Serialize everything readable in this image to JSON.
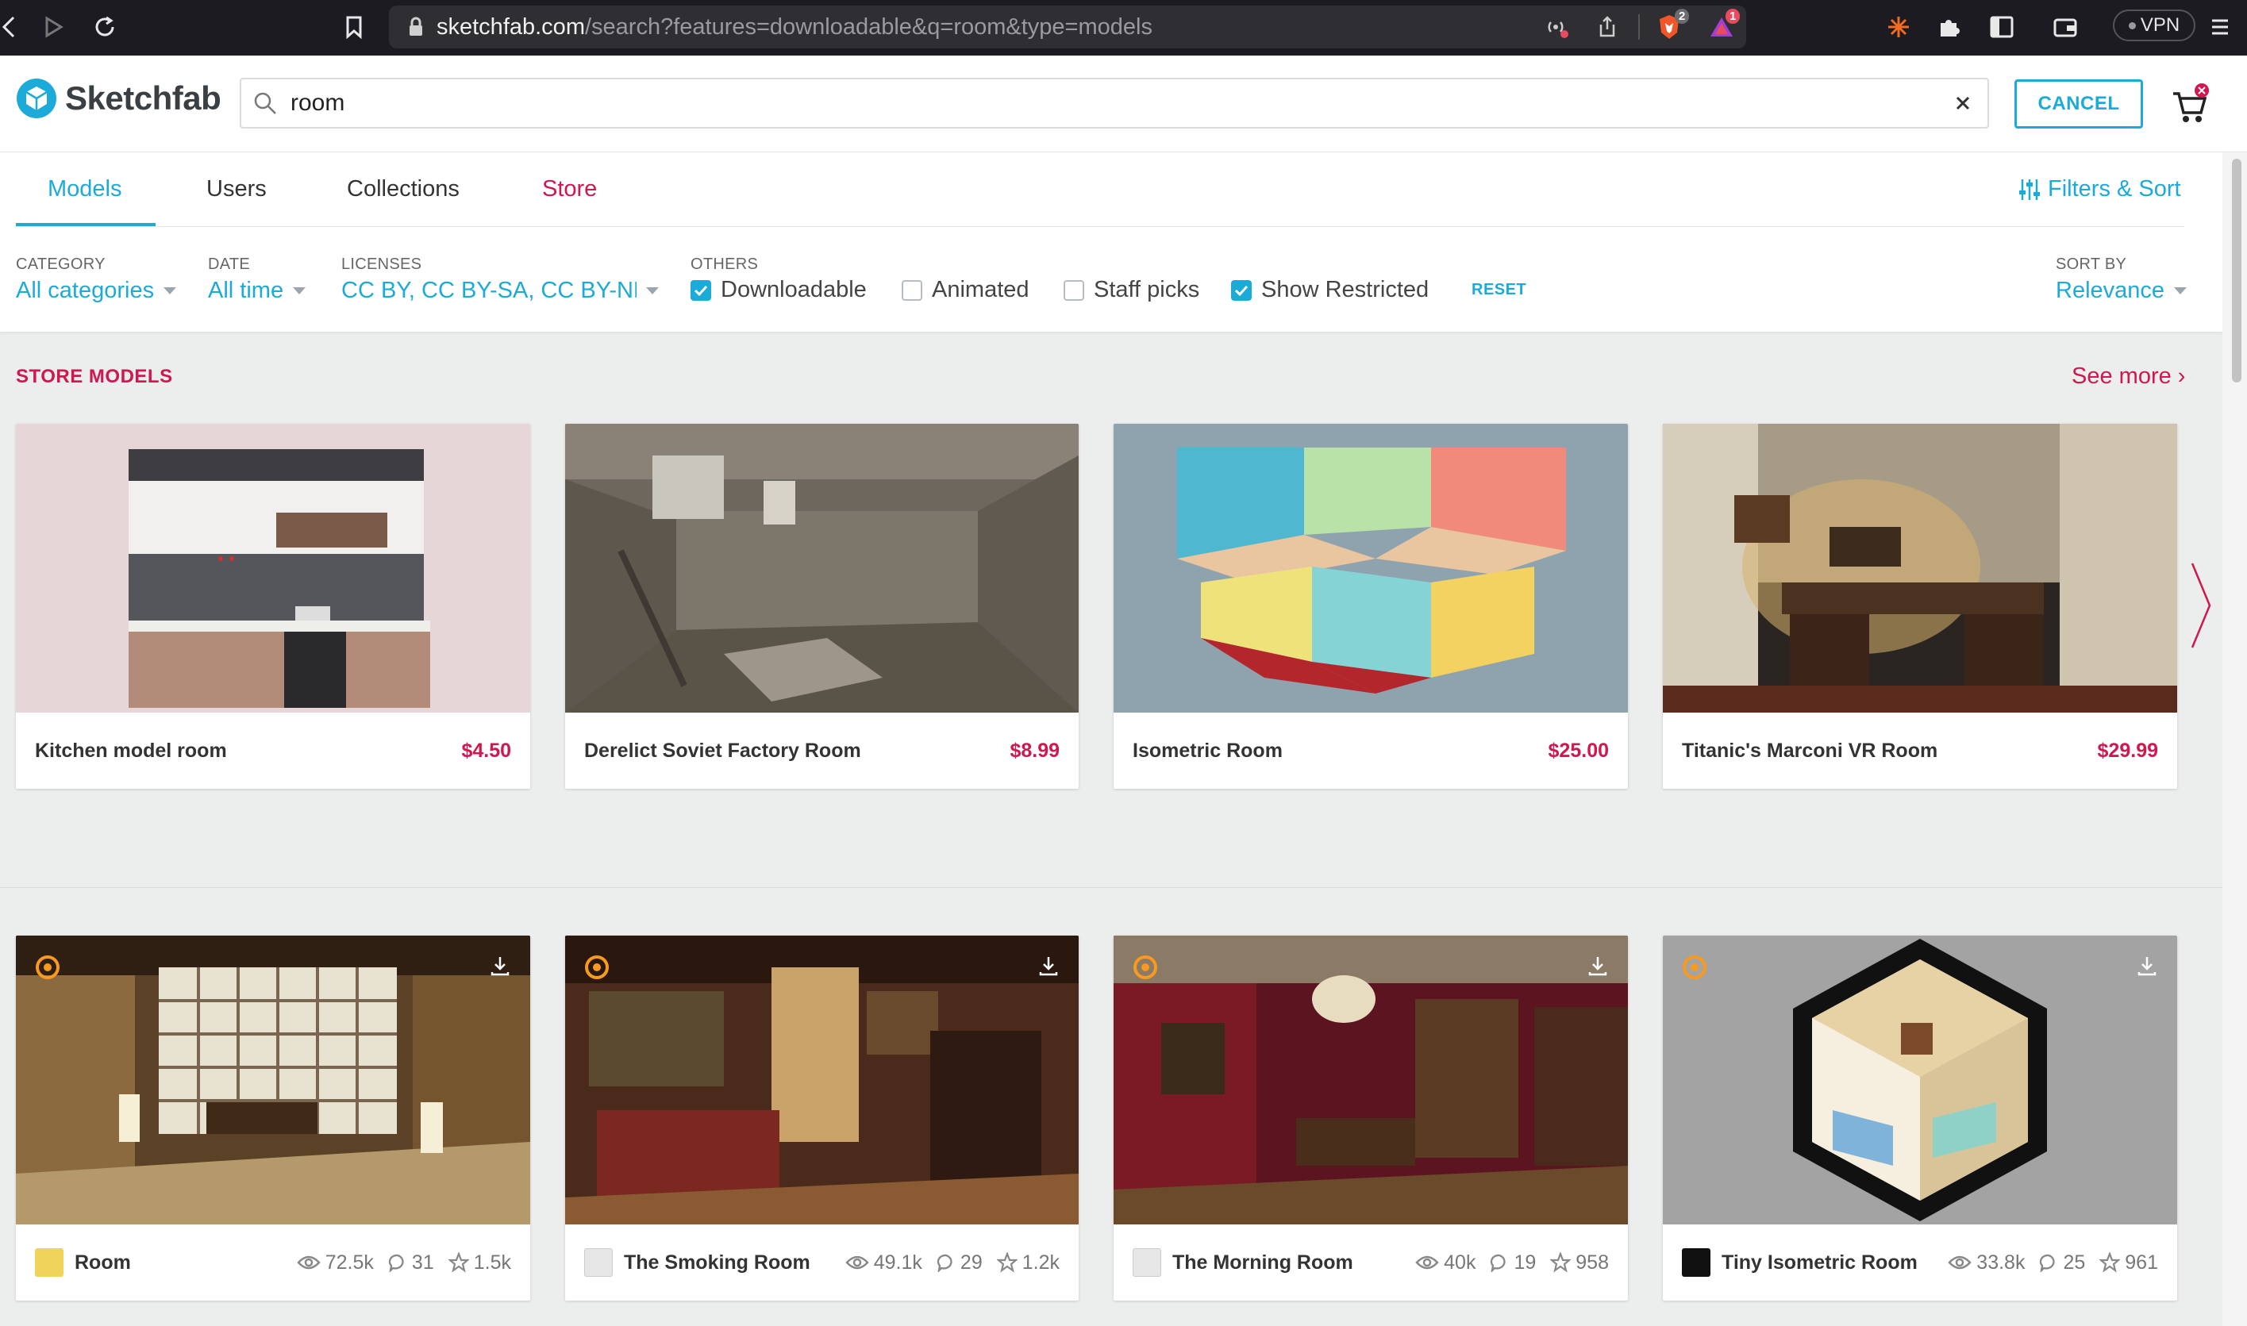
{
  "browser": {
    "url_host": "sketchfab.com",
    "url_path": "/search?features=downloadable&q=room&type=models",
    "brave_badge": "2",
    "rewards_badge": "1",
    "vpn_label": "VPN"
  },
  "header": {
    "logo_text": "Sketchfab",
    "search_value": "room",
    "cancel_label": "CANCEL"
  },
  "tabs": [
    {
      "label": "Models",
      "active": true
    },
    {
      "label": "Users"
    },
    {
      "label": "Collections"
    },
    {
      "label": "Store",
      "accent": "#d0174e"
    }
  ],
  "filters_sort_label": "Filters & Sort",
  "filters": {
    "category": {
      "label": "CATEGORY",
      "value": "All categories"
    },
    "date": {
      "label": "DATE",
      "value": "All time"
    },
    "licenses": {
      "label": "LICENSES",
      "value": "CC BY, CC BY-SA, CC BY-ND, C"
    },
    "others": {
      "label": "OTHERS"
    },
    "checkboxes": [
      {
        "label": "Downloadable",
        "checked": true
      },
      {
        "label": "Animated",
        "checked": false
      },
      {
        "label": "Staff picks",
        "checked": false
      },
      {
        "label": "Show Restricted",
        "checked": true
      }
    ],
    "reset_label": "RESET",
    "sort": {
      "label": "SORT BY",
      "value": "Relevance"
    }
  },
  "store": {
    "title": "STORE MODELS",
    "see_more": "See more ›",
    "items": [
      {
        "name": "Kitchen model room",
        "price": "$4.50"
      },
      {
        "name": "Derelict Soviet Factory Room",
        "price": "$8.99"
      },
      {
        "name": "Isometric Room",
        "price": "$25.00"
      },
      {
        "name": "Titanic's Marconi VR Room",
        "price": "$29.99"
      }
    ]
  },
  "models": [
    {
      "name": "Room",
      "views": "72.5k",
      "comments": "31",
      "likes": "1.5k"
    },
    {
      "name": "The Smoking Room",
      "views": "49.1k",
      "comments": "29",
      "likes": "1.2k"
    },
    {
      "name": "The Morning Room",
      "views": "40k",
      "comments": "19",
      "likes": "958"
    },
    {
      "name": "Tiny Isometric Room",
      "views": "33.8k",
      "comments": "25",
      "likes": "961"
    }
  ],
  "colors": {
    "accent": "#1caad9",
    "store": "#d0174e",
    "browser_bg": "#1c1b22"
  }
}
